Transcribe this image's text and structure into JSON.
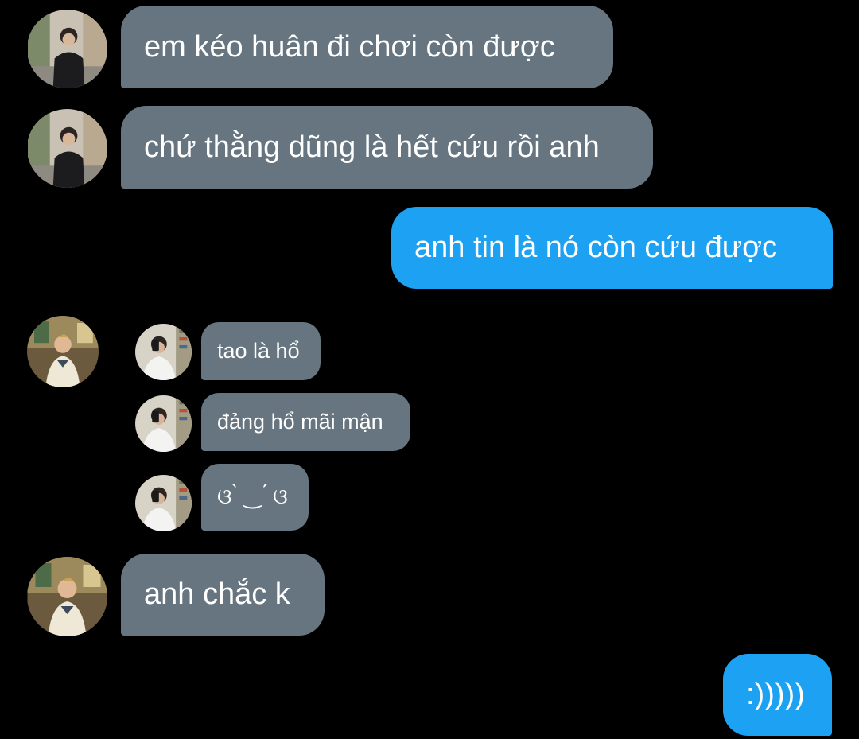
{
  "conversation": {
    "messages": [
      {
        "sender": "contact",
        "text": "em kéo huân đi chơi còn được"
      },
      {
        "sender": "contact",
        "text": "chứ thằng dũng là hết cứu rồi anh"
      },
      {
        "sender": "me",
        "text": "anh tin là nó còn cứu được"
      },
      {
        "sender": "contact",
        "quoted": true,
        "text": "tao là hổ"
      },
      {
        "sender": "contact",
        "quoted": true,
        "text": "đảng hổ mãi mận"
      },
      {
        "sender": "contact",
        "quoted": true,
        "text": "ଓ ̀ ‿ ́ ଓ"
      },
      {
        "sender": "contact",
        "text": "anh chắc k"
      },
      {
        "sender": "me",
        "text": ":)))))"
      }
    ]
  },
  "colors": {
    "background": "#000000",
    "received_bubble": "#66757f",
    "sent_bubble": "#1da1f2",
    "text": "#ffffff"
  },
  "icons": {
    "contact_avatar": "street-photo-avatar",
    "contact_avatar_alt": "cafe-photo-avatar",
    "quoted_avatar": "mirror-selfie-avatar"
  }
}
